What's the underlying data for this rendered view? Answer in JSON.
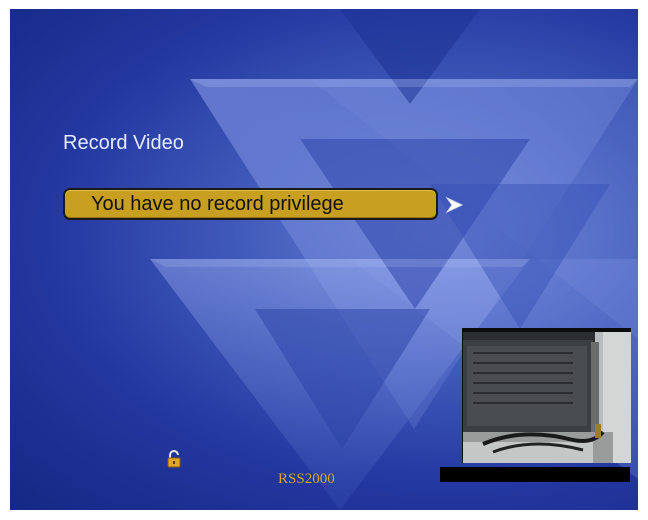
{
  "screen": {
    "title": "Record Video",
    "menu_item_label": "You have no record privilege",
    "brand": "RSS2000"
  },
  "icons": {
    "arrow": "chevron-right-icon",
    "lock": "unlocked-padlock-icon"
  },
  "colors": {
    "background_accent": "#2337a0",
    "menu_highlight": "#c89f20",
    "brand_text": "#d9a623"
  }
}
